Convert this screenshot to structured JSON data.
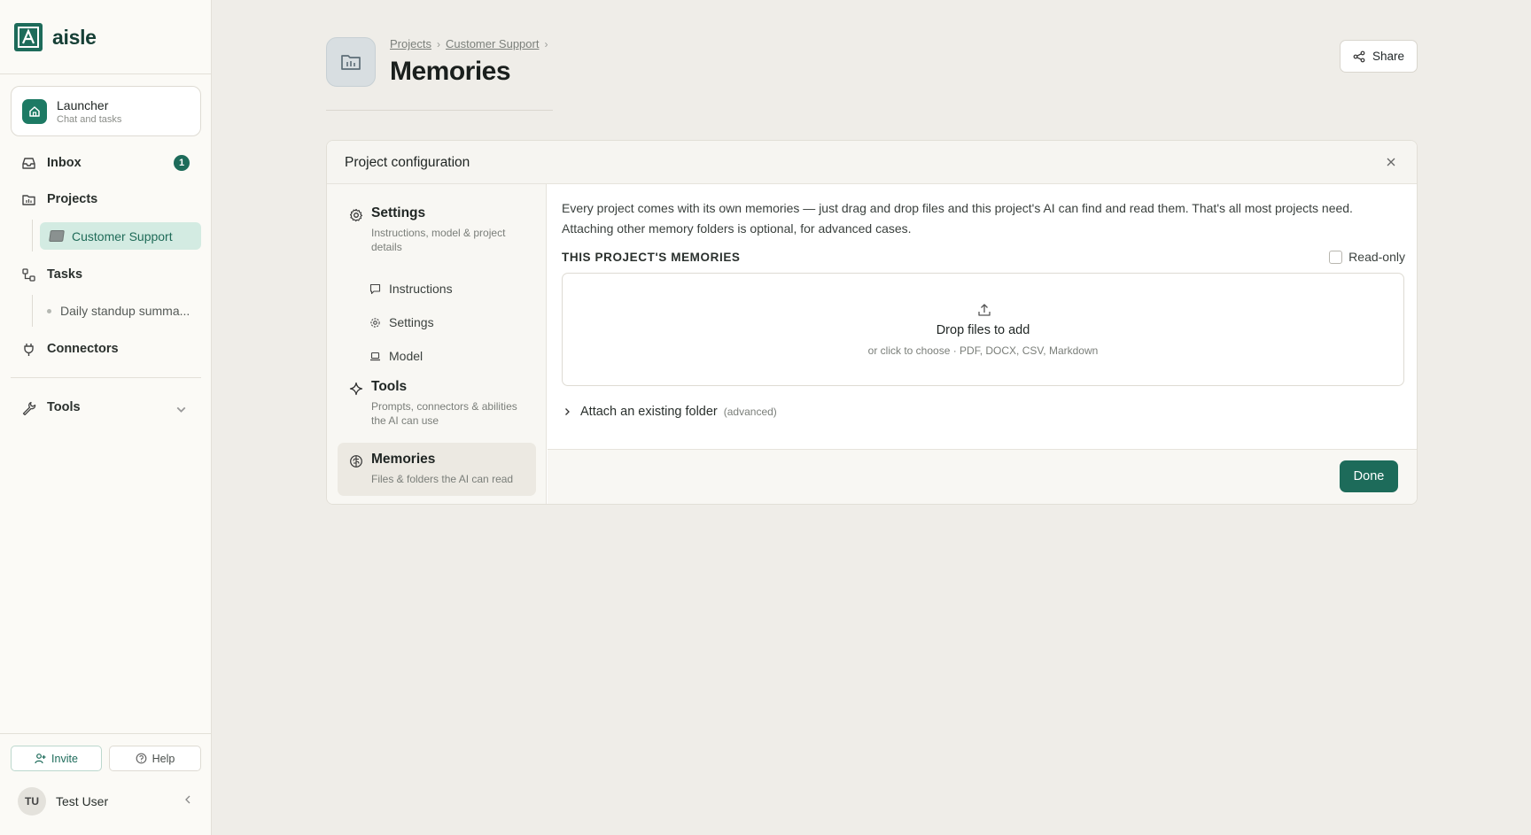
{
  "app": {
    "name": "aisle"
  },
  "sidebar": {
    "launcher": {
      "title": "Launcher",
      "subtitle": "Chat and tasks"
    },
    "inbox": {
      "label": "Inbox",
      "badge": "1"
    },
    "projects": {
      "label": "Projects",
      "active_project": "Customer Support"
    },
    "tasks": {
      "label": "Tasks",
      "task_item": "Daily standup summa..."
    },
    "connectors": {
      "label": "Connectors"
    },
    "tools": {
      "label": "Tools"
    },
    "footer": {
      "invite": "Invite",
      "help": "Help",
      "user_initials": "TU",
      "user_name": "Test User"
    }
  },
  "header": {
    "breadcrumb": [
      "Projects",
      "Customer Support"
    ],
    "title": "Memories",
    "share_label": "Share"
  },
  "panel": {
    "title": "Project configuration",
    "nav": {
      "settings": {
        "title": "Settings",
        "description": "Instructions, model & project details"
      },
      "sub_items": [
        "Instructions",
        "Settings",
        "Model"
      ],
      "tools": {
        "title": "Tools",
        "description": "Prompts, connectors & abilities the AI can use"
      },
      "memories": {
        "title": "Memories",
        "description": "Files & folders the AI can read"
      }
    },
    "main": {
      "intro": "Every project comes with its own memories — just drag and drop files and this project's AI can find and read them. That's all most projects need. Attaching other memory folders is optional, for advanced cases.",
      "section_label": "THIS PROJECT'S MEMORIES",
      "readonly_label": "Read-only",
      "dropzone": {
        "title": "Drop files to add",
        "subtitle": "or click to choose · PDF, DOCX, CSV, Markdown"
      },
      "attach": {
        "label": "Attach an existing folder",
        "tag": "(advanced)"
      },
      "done_label": "Done"
    }
  },
  "colors": {
    "accent": "#1d6b5a",
    "active_bg": "#d3ebe2",
    "page_bg": "#efede8"
  }
}
